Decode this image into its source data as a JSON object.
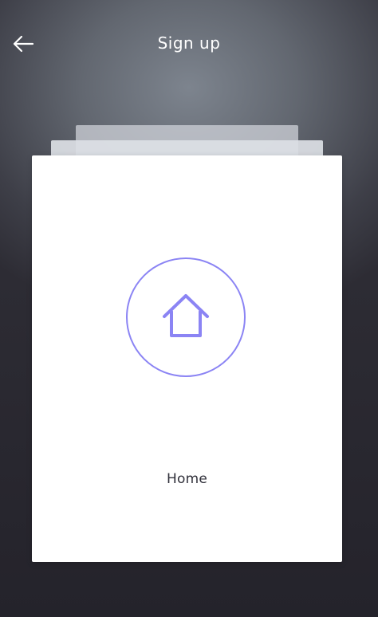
{
  "header": {
    "title": "Sign up",
    "back_icon": "back-arrow-icon"
  },
  "card": {
    "icon": "home-icon",
    "label": "Home"
  },
  "colors": {
    "accent": "#8b84f4",
    "card_background": "#ffffff",
    "header_text": "#ffffff",
    "label_text": "#30303a"
  }
}
